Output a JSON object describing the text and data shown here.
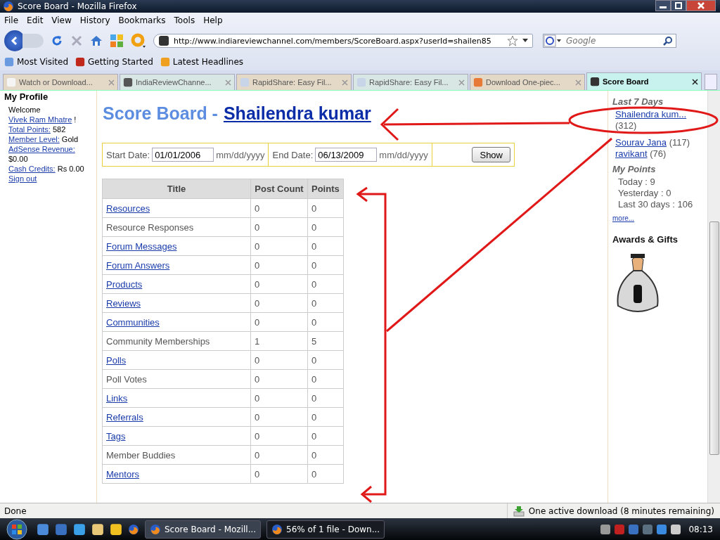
{
  "window": {
    "title": "Score Board - Mozilla Firefox"
  },
  "menu": [
    "File",
    "Edit",
    "View",
    "History",
    "Bookmarks",
    "Tools",
    "Help"
  ],
  "address": {
    "value": "http://www.indiareviewchannel.com/members/ScoreBoard.aspx?userId=shailen85"
  },
  "search": {
    "placeholder": "Google"
  },
  "bookmarks": [
    "Most Visited",
    "Getting Started",
    "Latest Headlines"
  ],
  "tabs": [
    {
      "label": "Watch or Download...",
      "selected": false
    },
    {
      "label": "IndiaReviewChanne...",
      "selected": false
    },
    {
      "label": "RapidShare: Easy Fil...",
      "selected": false
    },
    {
      "label": "RapidShare: Easy Fil...",
      "selected": false
    },
    {
      "label": "Download One-piec...",
      "selected": false
    },
    {
      "label": "Score Board",
      "selected": true
    }
  ],
  "profile": {
    "heading": "My Profile",
    "welcome": "Welcome",
    "user": "Vivek Ram Mhatre",
    "exclaim": "!",
    "stats": [
      {
        "label": "Total Points:",
        "value": "582"
      },
      {
        "label": "Member Level:",
        "value": "Gold"
      },
      {
        "label": "AdSense Revenue:",
        "value": "$0.00"
      },
      {
        "label": "Cash Credits:",
        "value": "Rs 0.00"
      }
    ],
    "signout": "Sign out"
  },
  "page": {
    "title": "Score Board -",
    "user": "Shailendra kumar"
  },
  "filter": {
    "start_label": "Start Date:",
    "start": "01/01/2006",
    "start_hint": "mm/dd/yyyy",
    "end_label": "End Date:",
    "end": "06/13/2009",
    "end_hint": "mm/dd/yyyy",
    "button": "Show"
  },
  "table": {
    "columns": [
      "Title",
      "Post Count",
      "Points"
    ],
    "rows": [
      {
        "title": "Resources",
        "link": true,
        "post_count": "0",
        "points": "0"
      },
      {
        "title": "Resource Responses",
        "link": false,
        "post_count": "0",
        "points": "0"
      },
      {
        "title": "Forum Messages",
        "link": true,
        "post_count": "0",
        "points": "0"
      },
      {
        "title": "Forum Answers",
        "link": true,
        "post_count": "0",
        "points": "0"
      },
      {
        "title": "Products",
        "link": true,
        "post_count": "0",
        "points": "0"
      },
      {
        "title": "Reviews",
        "link": true,
        "post_count": "0",
        "points": "0"
      },
      {
        "title": "Communities",
        "link": true,
        "post_count": "0",
        "points": "0"
      },
      {
        "title": "Community Memberships",
        "link": false,
        "post_count": "1",
        "points": "5"
      },
      {
        "title": "Polls",
        "link": true,
        "post_count": "0",
        "points": "0"
      },
      {
        "title": "Poll Votes",
        "link": false,
        "post_count": "0",
        "points": "0"
      },
      {
        "title": "Links",
        "link": true,
        "post_count": "0",
        "points": "0"
      },
      {
        "title": "Referrals",
        "link": true,
        "post_count": "0",
        "points": "0"
      },
      {
        "title": "Tags",
        "link": true,
        "post_count": "0",
        "points": "0"
      },
      {
        "title": "Member Buddies",
        "link": false,
        "post_count": "0",
        "points": "0"
      },
      {
        "title": "Mentors",
        "link": true,
        "post_count": "0",
        "points": "0"
      }
    ]
  },
  "right": {
    "top_heading": "Last 7 Days",
    "leaders": [
      {
        "name": "Shailendra kum...",
        "score": "(312)"
      },
      {
        "name": "Sourav Jana",
        "score": "(117)"
      },
      {
        "name": "ravikant",
        "score": "(76)"
      }
    ],
    "points_heading": "My Points",
    "points": [
      "Today : 9",
      "Yesterday : 0",
      "Last 30 days : 106"
    ],
    "more": "more...",
    "awards_heading": "Awards & Gifts"
  },
  "status": {
    "text": "Done",
    "download": "One active download (8 minutes remaining)"
  },
  "taskbar": {
    "buttons": [
      {
        "label": "Score Board - Mozill...",
        "selected": true
      },
      {
        "label": "56% of 1 file - Down...",
        "selected": false
      }
    ],
    "clock": "08:13"
  }
}
